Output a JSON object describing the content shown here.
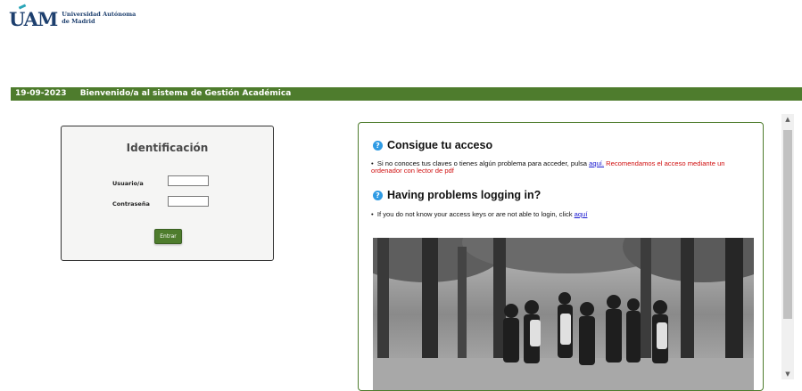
{
  "logo": {
    "mark": "UAM",
    "line1": "Universidad Autónoma",
    "line2": "de Madrid"
  },
  "topbar": {
    "date": "19-09-2023",
    "welcome": "Bienvenido/a al sistema de Gestión Académica"
  },
  "login": {
    "title": "Identificación",
    "user_label": "Usuario/a",
    "user_value": "",
    "password_label": "Contraseña",
    "password_value": "",
    "submit_label": "Entrar"
  },
  "access": {
    "es_title": "Consigue tu acceso",
    "es_text": "Si no conoces tus claves o tienes algún problema para acceder, pulsa ",
    "es_link": "aquí.",
    "es_red": " Recomendamos el acceso mediante un ordenador con lector de pdf",
    "en_title": "Having problems logging in?",
    "en_text": "If you do not know your access keys or are not able to login, click ",
    "en_link": "aquí"
  },
  "icons": {
    "help": "question-circle-icon",
    "scroll_up": "arrow-up-icon",
    "scroll_down": "arrow-down-icon"
  },
  "colors": {
    "brand_green": "#4e7c2d",
    "logo_blue": "#1d3f6e",
    "link_blue": "#1a1ad0",
    "warning_red": "#d01010"
  }
}
